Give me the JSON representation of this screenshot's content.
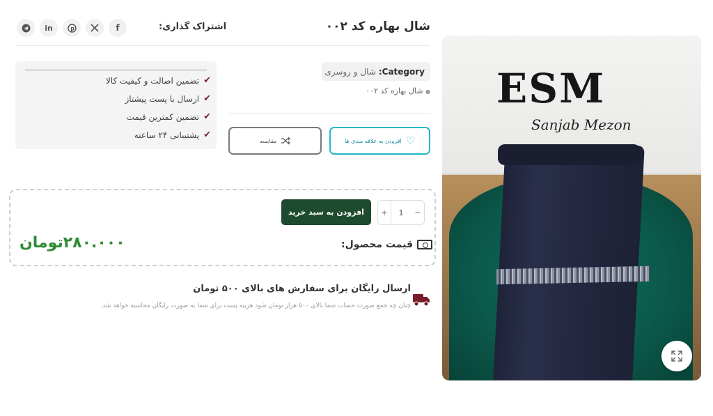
{
  "product": {
    "title": "شال بهاره کد ۰۰۲",
    "image_logo": "ESM",
    "image_logo_sub": "Sanjab Mezon"
  },
  "share": {
    "label": "اشتراک گذاری:",
    "networks": [
      "facebook-icon",
      "x-icon",
      "pinterest-icon",
      "linkedin-icon",
      "telegram-icon"
    ]
  },
  "guarantees": [
    "تضمین اصالت و کیفیت کالا",
    "ارسال با پست پیشتاز",
    "تضمین کمترین قیمت",
    "پشتیبانی ۲۴ ساعته"
  ],
  "category": {
    "key": "Category:",
    "value": "شال و روسری"
  },
  "bullet": "شال بهاره کد ۰۰۲",
  "actions": {
    "wishlist_label": "افزودن به علاقه مندی ها",
    "compare_label": "مقایسه"
  },
  "cart": {
    "quantity": "1",
    "plus": "+",
    "minus": "−",
    "add_label": "افزودن به سبد خرید",
    "price_label": "قیمت محصول:",
    "price_value": "۲۸۰.۰۰۰تومان"
  },
  "shipping": {
    "title": "ارسال رایگان برای سفارش های بالای ۵۰۰ تومان",
    "description": "چنان چه جمع صورت حساب شما بالای ۵۰۰ هزار تومان شود هزینه پست برای شما به صورت رایگان محاسبه خواهد شد."
  },
  "colors": {
    "accent_green": "#1e4b2f",
    "price_green": "#2e8b34",
    "wishlist_cyan": "#26b9c9",
    "check_maroon": "#7a1e2c"
  }
}
